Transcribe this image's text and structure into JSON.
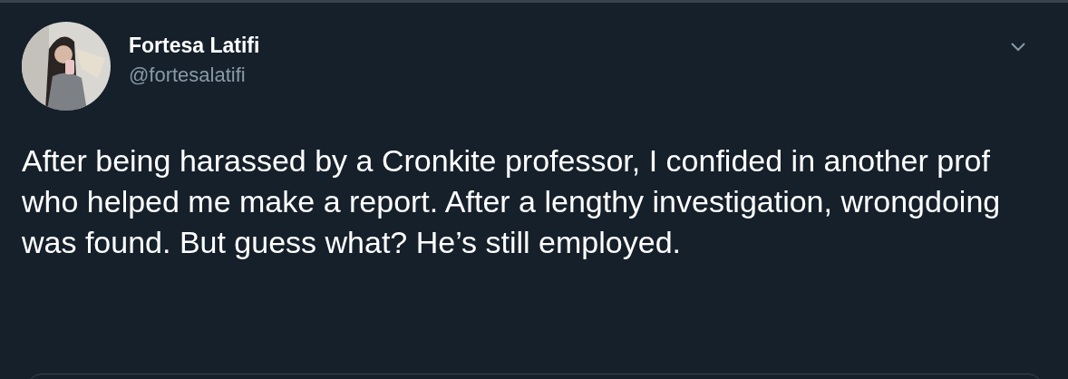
{
  "author": {
    "name": "Fortesa Latifi",
    "handle": "@fortesalatifi"
  },
  "tweet": {
    "text": "After being harassed by a Cronkite professor, I confided in another prof who helped me make a report. After a lengthy investigation, wrongdoing was found. But guess what? He’s still employed."
  }
}
